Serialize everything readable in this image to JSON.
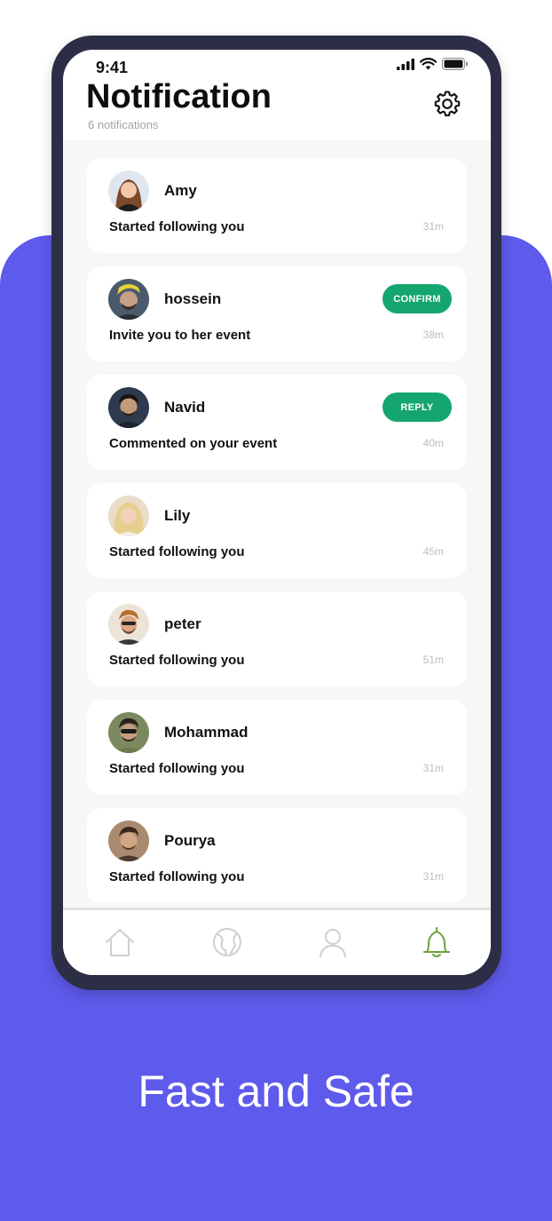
{
  "status_bar": {
    "time": "9:41"
  },
  "header": {
    "title": "Notification",
    "subtitle": "6 notifications"
  },
  "notifications": [
    {
      "name": "Amy",
      "message": "Started following you",
      "time": "31m",
      "action": ""
    },
    {
      "name": "hossein",
      "message": "Invite you to her event",
      "time": "38m",
      "action": "CONFIRM"
    },
    {
      "name": "Navid",
      "message": "Commented on your event",
      "time": "40m",
      "action": "REPLY"
    },
    {
      "name": "Lily",
      "message": "Started following you",
      "time": "45m",
      "action": ""
    },
    {
      "name": "peter",
      "message": "Started following you",
      "time": "51m",
      "action": ""
    },
    {
      "name": "Mohammad",
      "message": "Started following you",
      "time": "31m",
      "action": ""
    },
    {
      "name": "Pourya",
      "message": "Started following you",
      "time": "31m",
      "action": ""
    }
  ],
  "tabbar": {
    "items": [
      {
        "icon": "home-icon",
        "active": false
      },
      {
        "icon": "globe-icon",
        "active": false
      },
      {
        "icon": "user-icon",
        "active": false
      },
      {
        "icon": "bell-icon",
        "active": true
      }
    ]
  },
  "footer": {
    "tagline": "Fast and Safe"
  },
  "colors": {
    "background_accent": "#5e5aeb",
    "phone_frame": "#2c2e45",
    "button_green": "#15a66f",
    "active_tab": "#6aa33a",
    "inactive_tab": "#cfcfcf"
  }
}
